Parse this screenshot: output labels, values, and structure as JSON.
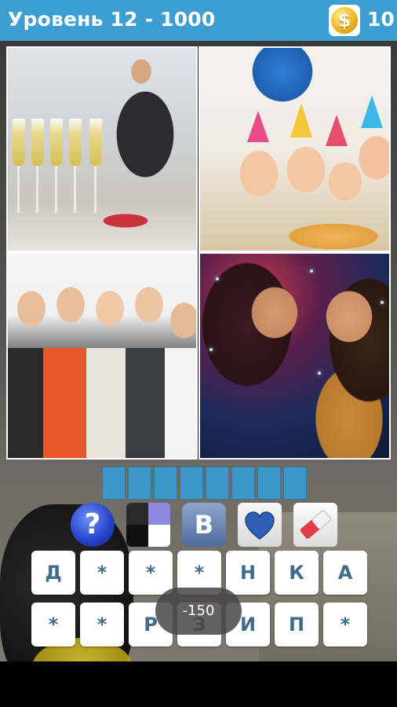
{
  "header": {
    "title": "Уровень 12 - 1000",
    "coin_symbol": "$",
    "coins": "10"
  },
  "photos": [
    {
      "name": "champagne-glasses"
    },
    {
      "name": "kids-birthday-party"
    },
    {
      "name": "girls-with-party-horns"
    },
    {
      "name": "dancing-girls"
    }
  ],
  "answer": {
    "slots": 8
  },
  "helpers": [
    {
      "name": "hint-question-icon",
      "label": "?"
    },
    {
      "name": "remove-letters-squares-icon"
    },
    {
      "name": "vk-share-icon",
      "label": "В"
    },
    {
      "name": "heart-icon"
    },
    {
      "name": "eraser-icon"
    }
  ],
  "keyboard": {
    "row1": [
      "Д",
      "*",
      "*",
      "*",
      "Н",
      "К",
      "А"
    ],
    "row2": [
      "*",
      "*",
      "Р",
      "З",
      "И",
      "П",
      "*"
    ]
  },
  "penalty_label": "-150",
  "colors": {
    "topbar": "#3c9ed2",
    "slot": "#3e97c9",
    "key_text": "#3d6d8b"
  }
}
